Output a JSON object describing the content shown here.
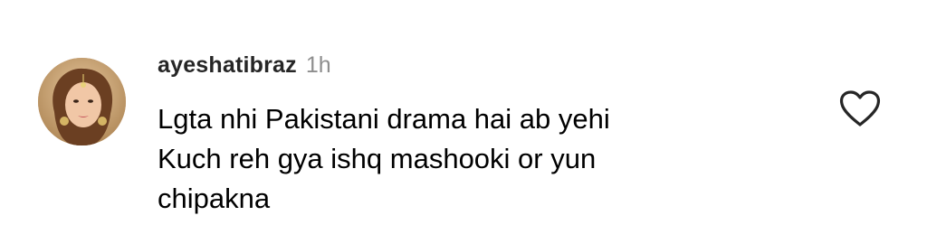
{
  "comment": {
    "username": "ayeshatibraz",
    "time": "1h",
    "text_lines": [
      "Lgta nhi Pakistani drama hai ab yehi",
      "Kuch reh gya ishq mashooki or yun",
      "chipakna"
    ],
    "like_icon": "heart-outline-icon",
    "avatar_icon": "profile-photo"
  },
  "colors": {
    "username": "#262626",
    "time": "#8e8e8e",
    "text": "#000000",
    "icon": "#262626",
    "background": "#ffffff"
  }
}
